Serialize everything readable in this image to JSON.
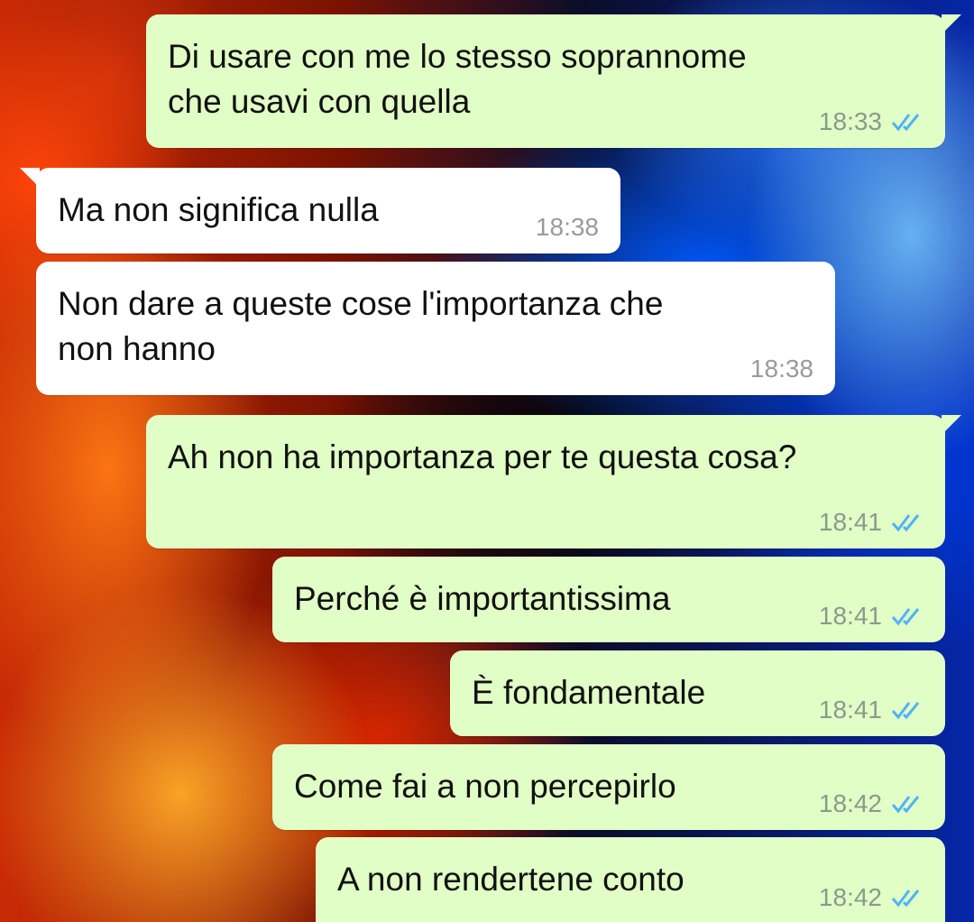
{
  "messages": [
    {
      "dir": "out",
      "text": "Di usare con me lo stesso soprannome\nche usavi con quella",
      "time": "18:33",
      "ticks": "double-check-icon"
    },
    {
      "dir": "in",
      "text": "Ma non significa nulla",
      "time": "18:38"
    },
    {
      "dir": "in",
      "text": "Non dare a queste cose l'importanza che\nnon hanno",
      "time": "18:38"
    },
    {
      "dir": "out",
      "text": "Ah non ha importanza per te questa cosa?",
      "time": "18:41",
      "ticks": "double-check-icon"
    },
    {
      "dir": "out",
      "text": "Perché è importantissima",
      "time": "18:41",
      "ticks": "double-check-icon"
    },
    {
      "dir": "out",
      "text": "È fondamentale",
      "time": "18:41",
      "ticks": "double-check-icon"
    },
    {
      "dir": "out",
      "text": "Come fai a non percepirlo",
      "time": "18:42",
      "ticks": "double-check-icon"
    },
    {
      "dir": "out",
      "text": "A non rendertene conto",
      "time": "18:42",
      "ticks": "double-check-icon"
    }
  ],
  "colors": {
    "outgoing_bubble": "#e1fec6",
    "incoming_bubble": "#ffffff",
    "read_ticks": "#4fb3f6"
  }
}
